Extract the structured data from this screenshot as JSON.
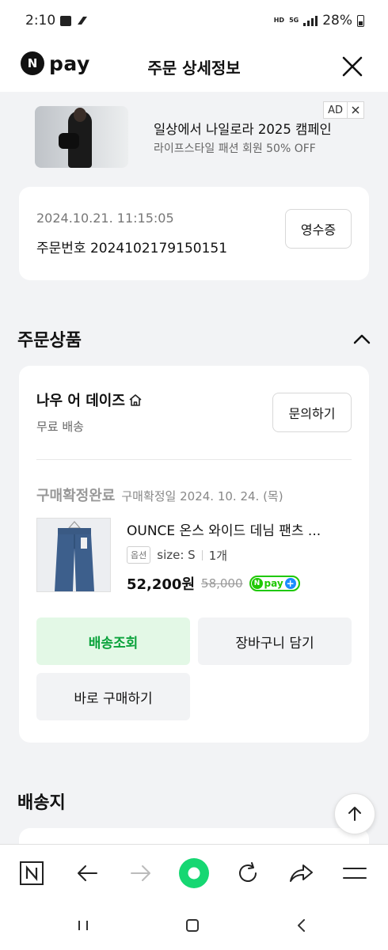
{
  "status_bar": {
    "time": "2:10",
    "network_hd": "HD",
    "network_5g": "5G",
    "battery": "28%"
  },
  "header": {
    "logo_text": "pay",
    "logo_mark": "N",
    "title": "주문 상세정보"
  },
  "ad": {
    "title": "일상에서 나일로라 2025 캠페인",
    "subtitle": "라이프스타일 패션 회원 50% OFF",
    "badge": "AD"
  },
  "order": {
    "datetime": "2024.10.21. 11:15:05",
    "number_label": "주문번호 2024102179150151",
    "receipt_button": "영수증"
  },
  "products_section": {
    "title": "주문상품",
    "seller": "나우 어 데이즈",
    "shipping": "무료 배송",
    "inquiry_button": "문의하기",
    "status": "구매확정완료",
    "status_date": "구매확정일 2024. 10. 24. (목)",
    "product_name": "OUNCE 온스 와이드 데님 팬츠 ...",
    "option_badge": "옵션",
    "option_size": "size: S",
    "quantity": "1개",
    "price": "52,200원",
    "original_price": "58,000",
    "npay_mark": "N",
    "npay_text": "pay",
    "track_button": "배송조회",
    "cart_button": "장바구니 담기",
    "buy_button": "바로 구매하기"
  },
  "address_section": {
    "title": "배송지"
  },
  "toolbar": {
    "home_mark": "N"
  },
  "colors": {
    "accent_green": "#0aa23b",
    "track_bg": "#e3f8e6",
    "naver_green": "#1ec800",
    "page_bg": "#f2f3f5"
  }
}
